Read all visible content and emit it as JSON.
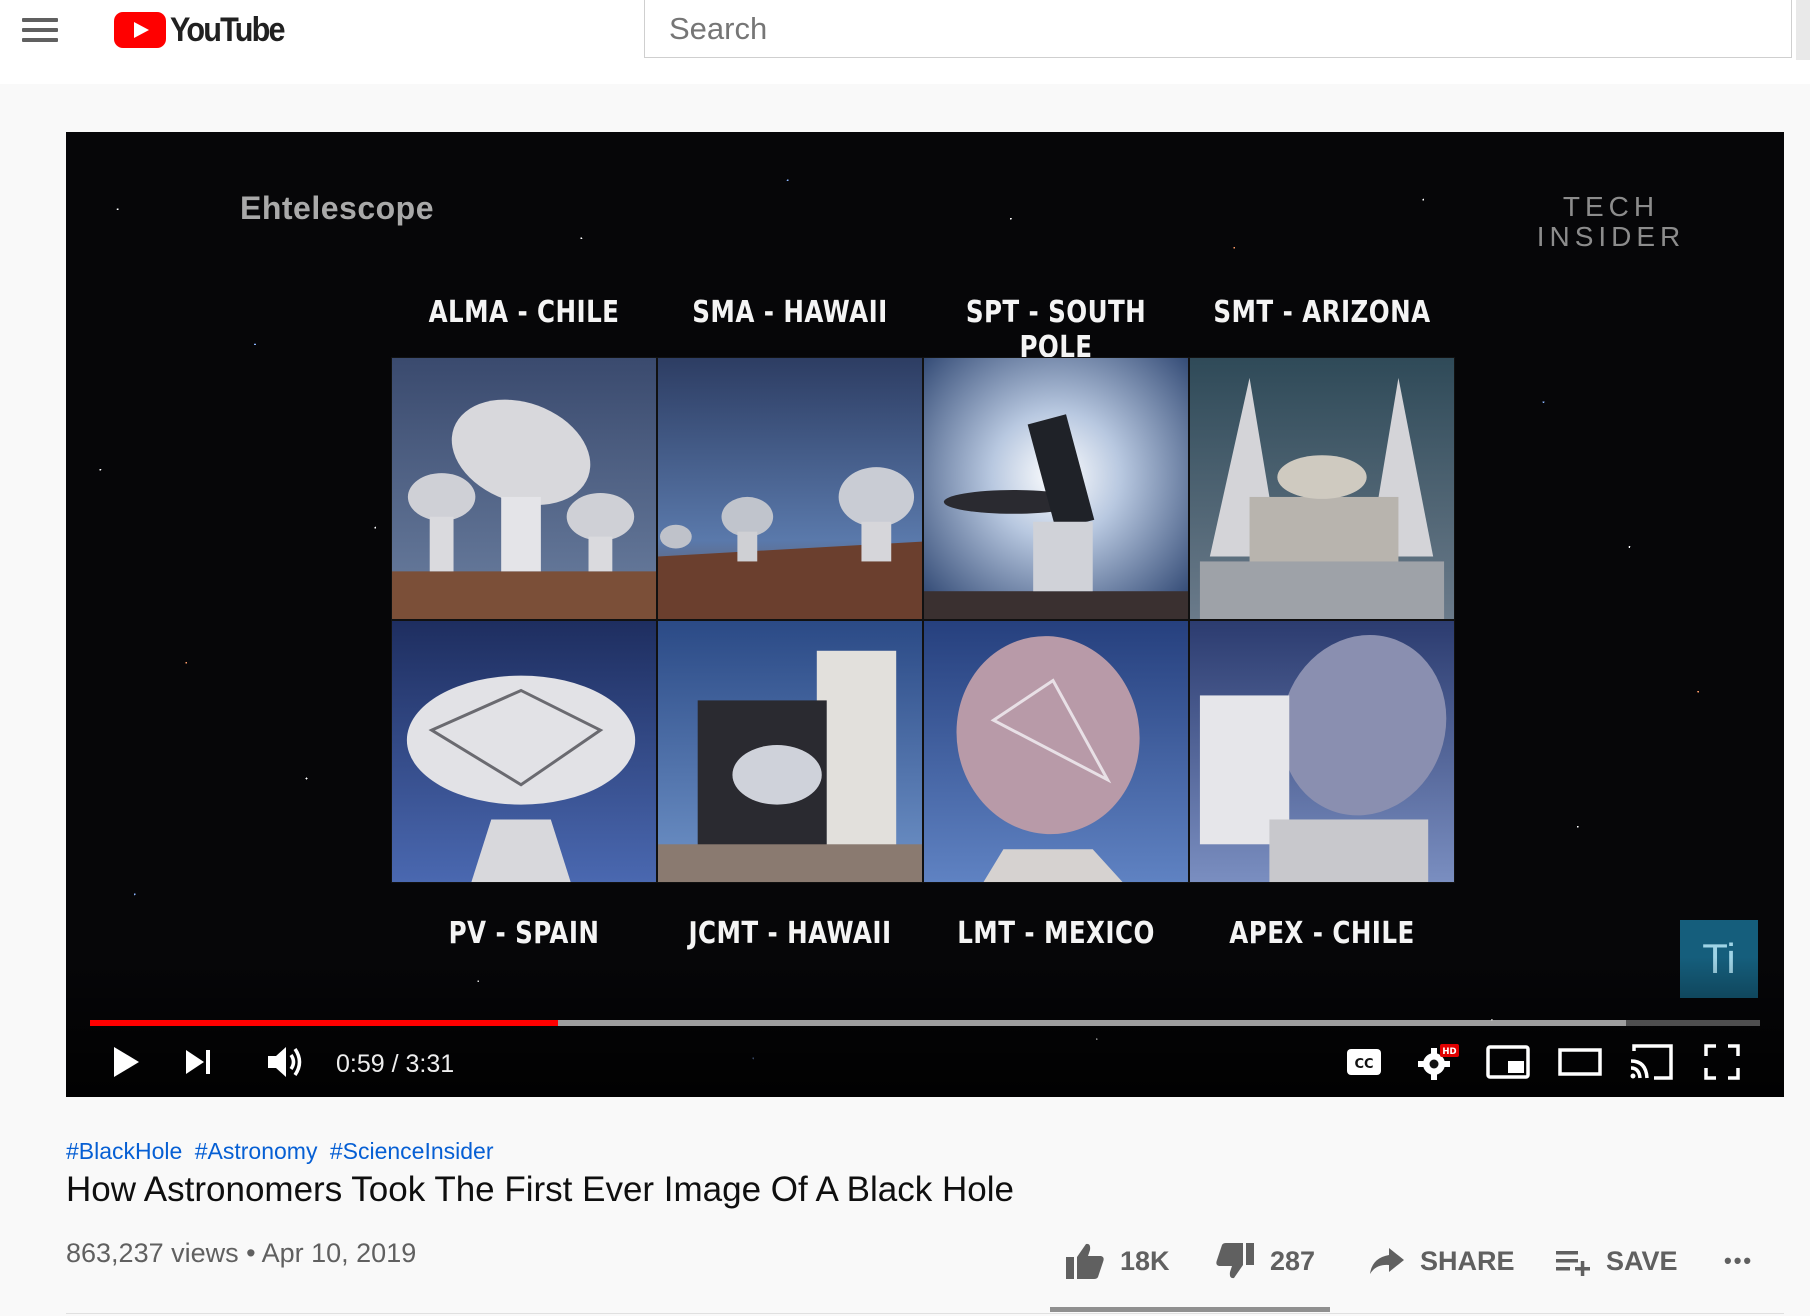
{
  "masthead": {
    "logo_text": "YouTube",
    "search_placeholder": "Search"
  },
  "player": {
    "overlay_brand": "Ehtelescope",
    "channel_watermark": [
      "TECH",
      "INSIDER"
    ],
    "corner_badge": "Ti",
    "sites_top": [
      "ALMA - CHILE",
      "SMA - HAWAII",
      "SPT - SOUTH POLE",
      "SMT - ARIZONA"
    ],
    "sites_bottom": [
      "PV - SPAIN",
      "JCMT - HAWAII",
      "LMT - MEXICO",
      "APEX - CHILE"
    ],
    "current_time": "0:59",
    "duration": "3:31",
    "time_display": "0:59 / 3:31",
    "progress_played_fraction": 0.28,
    "progress_loaded_fraction": 0.92,
    "progress_color": "#ff0000",
    "controls": {
      "play": "play-icon",
      "next": "next-icon",
      "volume": "volume-icon",
      "captions": "CC",
      "settings_badge": "HD",
      "miniplayer": "miniplayer-icon",
      "theater": "theater-icon",
      "cast": "cast-icon",
      "fullscreen": "fullscreen-icon"
    }
  },
  "video": {
    "hashtags": [
      "#BlackHole",
      "#Astronomy",
      "#ScienceInsider"
    ],
    "title": "How Astronomers Took The First Ever Image Of A Black Hole",
    "views": "863,237 views",
    "separator": "•",
    "date": "Apr 10, 2019",
    "likes": "18K",
    "dislikes": "287",
    "share_label": "SHARE",
    "save_label": "SAVE",
    "more_label": "•••",
    "link_color": "#065fd4"
  }
}
